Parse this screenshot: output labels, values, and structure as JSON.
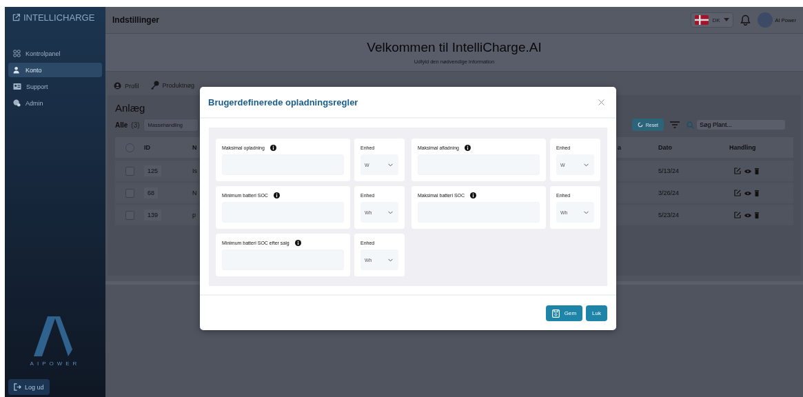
{
  "sidebar": {
    "brand": "INTELLICHARGE",
    "items": [
      {
        "label": "Kontrolpanel",
        "selected": false
      },
      {
        "label": "Konto",
        "selected": true
      },
      {
        "label": "Support",
        "selected": false
      },
      {
        "label": "Admin",
        "selected": false
      }
    ],
    "logo_text": "AIPOWER",
    "logout": "Log ud"
  },
  "topbar": {
    "title": "Indstillinger",
    "language": "DK",
    "user": "AI Power"
  },
  "welcome": {
    "title": "Velkommen til IntelliCharge.AI",
    "subtitle": "Udfyld den nødvendige information"
  },
  "tabs": [
    {
      "label": "Profil",
      "selected": false
    },
    {
      "label": "Produktnøg",
      "selected": false
    }
  ],
  "plants": {
    "title": "Anlæg",
    "filter": "Alle",
    "count": "(3)",
    "bulk": "Massehandling",
    "reset": "Reset",
    "search": {
      "placeholder": "Søg Plant..."
    },
    "select_all": {
      "checked": false
    },
    "columns": [
      "ID",
      "N",
      "a",
      "Dato",
      "Handling"
    ],
    "rows": [
      {
        "id": "125",
        "column_3": "Is",
        "date": "5/13/24",
        "checked": false
      },
      {
        "id": "68",
        "column_3": "N",
        "date": "3/26/24",
        "checked": false
      },
      {
        "id": "139",
        "column_3": "p",
        "date": "5/23/24",
        "checked": false
      }
    ]
  },
  "modal": {
    "title": "Brugerdefinerede opladningsregler",
    "fields": [
      {
        "label": "Maksimal opladning",
        "unit_label": "Enhed",
        "unit": "W"
      },
      {
        "label": "Maksimal afladning",
        "unit_label": "Enhed",
        "unit": "W"
      },
      {
        "label": "Minimum batteri SOC",
        "unit_label": "Enhed",
        "unit": "Wh"
      },
      {
        "label": "Maksimal batteri SOC",
        "unit_label": "Enhed",
        "unit": "Wh"
      },
      {
        "label": "Minimum batteri SOC efter salg",
        "unit_label": "Enhed",
        "unit": "Wh"
      }
    ],
    "buttons": [
      {
        "label": "Gem",
        "kind": "save"
      },
      {
        "label": "Luk",
        "kind": "close"
      }
    ]
  }
}
